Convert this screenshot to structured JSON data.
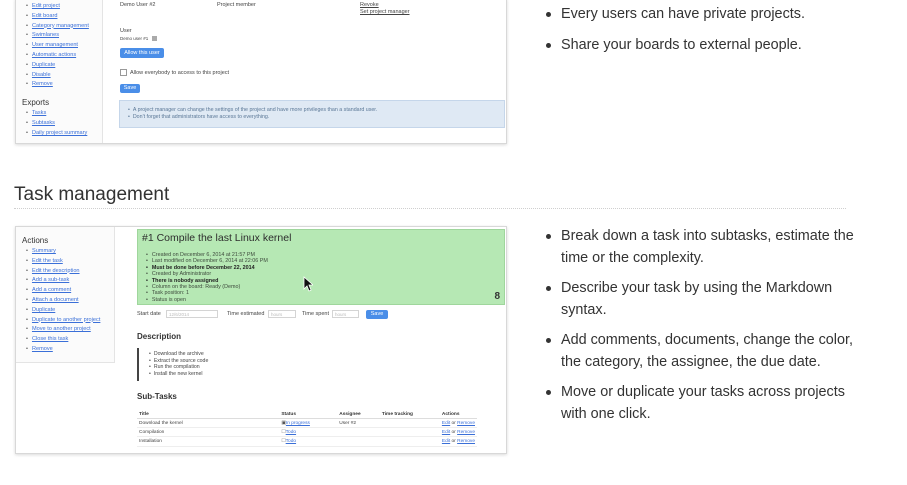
{
  "top_screenshot": {
    "sidebar": {
      "items": [
        "Edit project",
        "Edit board",
        "Category management",
        "Swimlanes",
        "User management",
        "Automatic actions",
        "Duplicate",
        "Disable",
        "Remove"
      ],
      "exports_title": "Exports",
      "export_items": [
        "Tasks",
        "Subtasks",
        "Daily project summary"
      ]
    },
    "member_row": {
      "user": "Demo User #2",
      "role": "Project member",
      "actions": [
        "Revoke",
        "Set project manager"
      ]
    },
    "user_label": "User",
    "user_select_value": "Demo user #1",
    "allow_user_button": "Allow this user",
    "allow_everybody_label": "Allow everybody to access to this project",
    "save_button": "Save",
    "info": [
      "A project manager can change the settings of the project and have more privileges than a standard user.",
      "Don't forget that administrators have access to everything."
    ]
  },
  "features_top": [
    "Every users can have private projects.",
    "Share your boards to external people."
  ],
  "section_title": "Task management",
  "bottom_screenshot": {
    "sidebar": {
      "title": "Actions",
      "items": [
        "Summary",
        "Edit the task",
        "Edit the description",
        "Add a sub-task",
        "Add a comment",
        "Attach a document",
        "Duplicate",
        "Duplicate to another project",
        "Move to another project",
        "Close this task",
        "Remove"
      ]
    },
    "task": {
      "title": "#1 Compile the last Linux kernel",
      "meta": [
        "Created on December 6, 2014 at 21:57 PM",
        "Last modified on December 6, 2014 at 22:06 PM",
        "Must be done before December 22, 2014",
        "Created by Administrator",
        "There is nobody assigned",
        "Column on the board: Ready (Demo)",
        "Task position: 1",
        "Status is open"
      ],
      "number": "8"
    },
    "form": {
      "start_date_label": "Start date",
      "start_date_placeholder": "12/6/2014",
      "time_estimated_label": "Time estimated",
      "time_estimated_placeholder": "hours",
      "time_spent_label": "Time spent",
      "time_spent_placeholder": "hours",
      "save_button": "Save"
    },
    "description_title": "Description",
    "description_items": [
      "Download the archive",
      "Extract the source code",
      "Run the compilation",
      "Install the new kernel"
    ],
    "subtasks_title": "Sub-Tasks",
    "subtasks": {
      "headers": [
        "Title",
        "Status",
        "Assignee",
        "Time tracking",
        "Actions"
      ],
      "rows": [
        {
          "title": "Download the kernel",
          "status": "In progress",
          "assignee": "User #2",
          "time": "",
          "edit": "Edit",
          "or": "or",
          "remove": "Remove"
        },
        {
          "title": "Compilation",
          "status": "Todo",
          "assignee": "",
          "time": "",
          "edit": "Edit",
          "or": "or",
          "remove": "Remove"
        },
        {
          "title": "Installation",
          "status": "Todo",
          "assignee": "",
          "time": "",
          "edit": "Edit",
          "or": "or",
          "remove": "Remove"
        }
      ]
    }
  },
  "features_bottom": [
    "Break down a task into subtasks, estimate the time or the complexity.",
    "Describe your task by using the Markdown syntax.",
    "Add comments, documents, change the color, the category, the assignee, the due date.",
    "Move or duplicate your tasks across projects with one click."
  ],
  "colors": {
    "link": "#3a6fd8",
    "button": "#4a8ee8",
    "task_green": "#b6e8b4",
    "info_blue": "#dfe9f4"
  }
}
